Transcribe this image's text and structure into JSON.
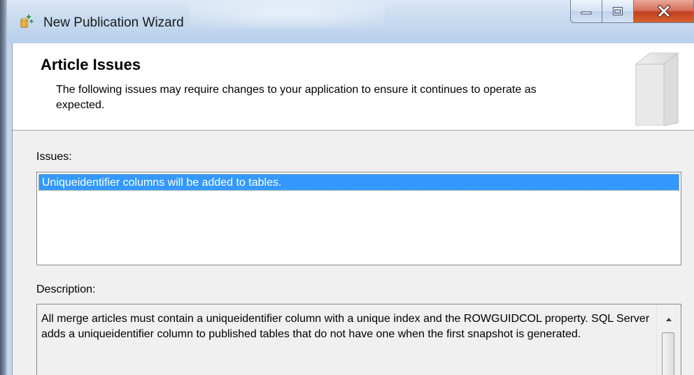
{
  "window": {
    "title": "New Publication Wizard"
  },
  "header": {
    "title": "Article Issues",
    "description": "The following issues may require changes to your application to ensure it continues to operate as expected."
  },
  "issues": {
    "label": "Issues:",
    "items": [
      {
        "text": "Uniqueidentifier columns will be added to tables.",
        "selected": true
      }
    ]
  },
  "description": {
    "label": "Description:",
    "text": "All merge articles must contain a uniqueidentifier column with a unique index and the ROWGUIDCOL property. SQL Server adds a uniqueidentifier column to published tables that do not have one when the first snapshot is generated."
  },
  "colors": {
    "selection": "#3399ff",
    "titlebar": "#c7daf0",
    "close_button": "#c2401f"
  }
}
